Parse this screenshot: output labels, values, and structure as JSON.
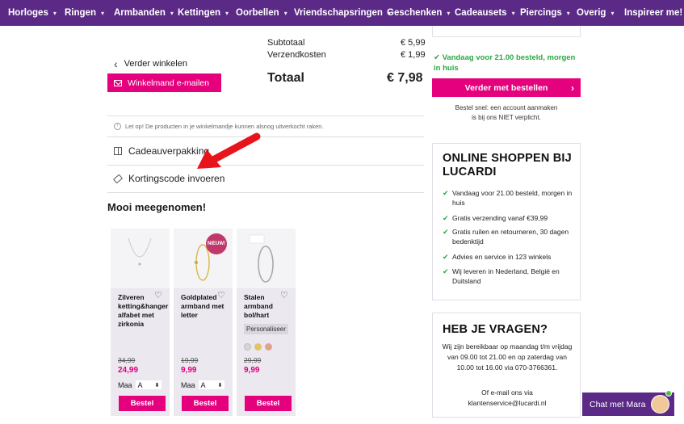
{
  "nav": {
    "items": [
      "Horloges",
      "Ringen",
      "Armbanden",
      "Kettingen",
      "Oorbellen",
      "Vriendschapsringen",
      "Geschenken",
      "Cadeausets",
      "Piercings",
      "Overig",
      "Inspireer me!"
    ]
  },
  "summary": {
    "subtotal_label": "Subtotaal",
    "subtotal_value": "€ 5,99",
    "shipping_label": "Verzendkosten",
    "shipping_value": "€ 1,99",
    "total_label": "Totaal",
    "total_value": "€ 7,98"
  },
  "actions": {
    "continue_label": "Verder winkelen",
    "email_label": "Winkelmand e-mailen"
  },
  "notice": "Let op! De producten in je winkelmandje kunnen alsnog uitverkocht raken.",
  "options": {
    "gift_label": "Cadeauverpakking",
    "discount_label": "Kortingscode invoeren"
  },
  "recommend": {
    "title": "Mooi meegenomen!",
    "products": [
      {
        "name": "Zilveren ketting&hanger alfabet met zirkonia",
        "old_price": "34,99",
        "price": "24,99",
        "size_label": "Maa",
        "size_value": "A",
        "button": "Bestel"
      },
      {
        "name": "Goldplated armband met letter",
        "old_price": "19,99",
        "price": "9,99",
        "size_label": "Maa",
        "size_value": "A",
        "button": "Bestel",
        "badge": "NIEUW!"
      },
      {
        "name": "Stalen armband bol/hart",
        "old_price": "29,99",
        "price": "9,99",
        "personalise": "Personaliseer",
        "button": "Bestel"
      }
    ]
  },
  "checkout": {
    "delivery_note": "Vandaag voor 21.00 besteld, morgen in huis",
    "cta_label": "Verder met bestellen",
    "fast_order_line1": "Bestel snel: een account aanmaken",
    "fast_order_line2": "is bij ons NIET verplicht."
  },
  "usp_box": {
    "title": "ONLINE SHOPPEN BIJ LUCARDI",
    "items": [
      "Vandaag voor 21.00 besteld, morgen in huis",
      "Gratis verzending vanaf €39,99",
      "Gratis ruilen en retourneren, 30 dagen bedenktijd",
      "Advies en service in 123 winkels",
      "Wij leveren in Nederland, België en Duitsland"
    ]
  },
  "questions_box": {
    "title": "HEB JE VRAGEN?",
    "line1": "Wij zijn bereikbaar op maandag t/m vrijdag",
    "line2": "van 09.00 tot 21.00 en op zaterdag van",
    "line3": "10.00 tot 16.00 via 070-3766361.",
    "line4": "Of e-mail ons via",
    "line5": "klantenservice@lucardi.nl"
  },
  "chat": {
    "label": "Chat met Mara"
  },
  "colors": {
    "brand_purple": "#5b2a86",
    "brand_pink": "#e5007e",
    "check_green": "#29a843"
  }
}
